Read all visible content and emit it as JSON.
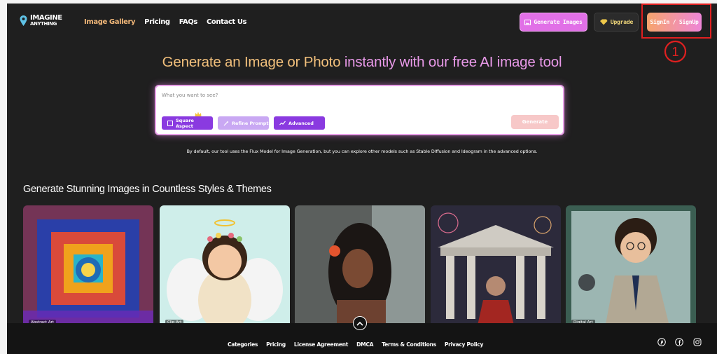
{
  "header": {
    "logo": {
      "line1": "IMAGINE",
      "line2": "ANYTHING"
    },
    "nav": [
      {
        "label": "Image Gallery",
        "active": true
      },
      {
        "label": "Pricing"
      },
      {
        "label": "FAQs"
      },
      {
        "label": "Contact Us"
      }
    ],
    "generate_button": "Generate Images",
    "upgrade_button": "Upgrade",
    "signin_button": "SignIn / SignUp"
  },
  "annotation": {
    "marker": "①",
    "color": "#e02020"
  },
  "hero": {
    "title_part1": "Generate an Image or Photo",
    "title_part2": "instantly with our free AI image tool",
    "prompt_placeholder": "What you want to see?",
    "square_aspect": "Square Aspect",
    "refine_prompt": "Refine Prompt",
    "advanced": "Advanced",
    "generate": "Generate",
    "disclaimer": "By default, our tool uses the Flux Model for Image Generation, but you can explore other models such as Stable Diffusion and Ideogram in the advanced options."
  },
  "gallery": {
    "title": "Generate Stunning Images in Countless Styles & Themes",
    "cards": [
      {
        "tag": "Abstract Art"
      },
      {
        "tag": "Clip Art"
      },
      {
        "tag": ""
      },
      {
        "tag": ""
      },
      {
        "tag": "Digital Art"
      }
    ]
  },
  "footer": {
    "links": [
      "Categories",
      "Pricing",
      "License Agreement",
      "DMCA",
      "Terms & Conditions",
      "Privacy Policy"
    ],
    "social": [
      "pinterest-icon",
      "facebook-icon",
      "instagram-icon"
    ]
  },
  "colors": {
    "background": "#1f1f1f",
    "accent_pink": "#e170e7",
    "accent_orange": "#f2c07c",
    "purple": "#8a3ae0"
  }
}
